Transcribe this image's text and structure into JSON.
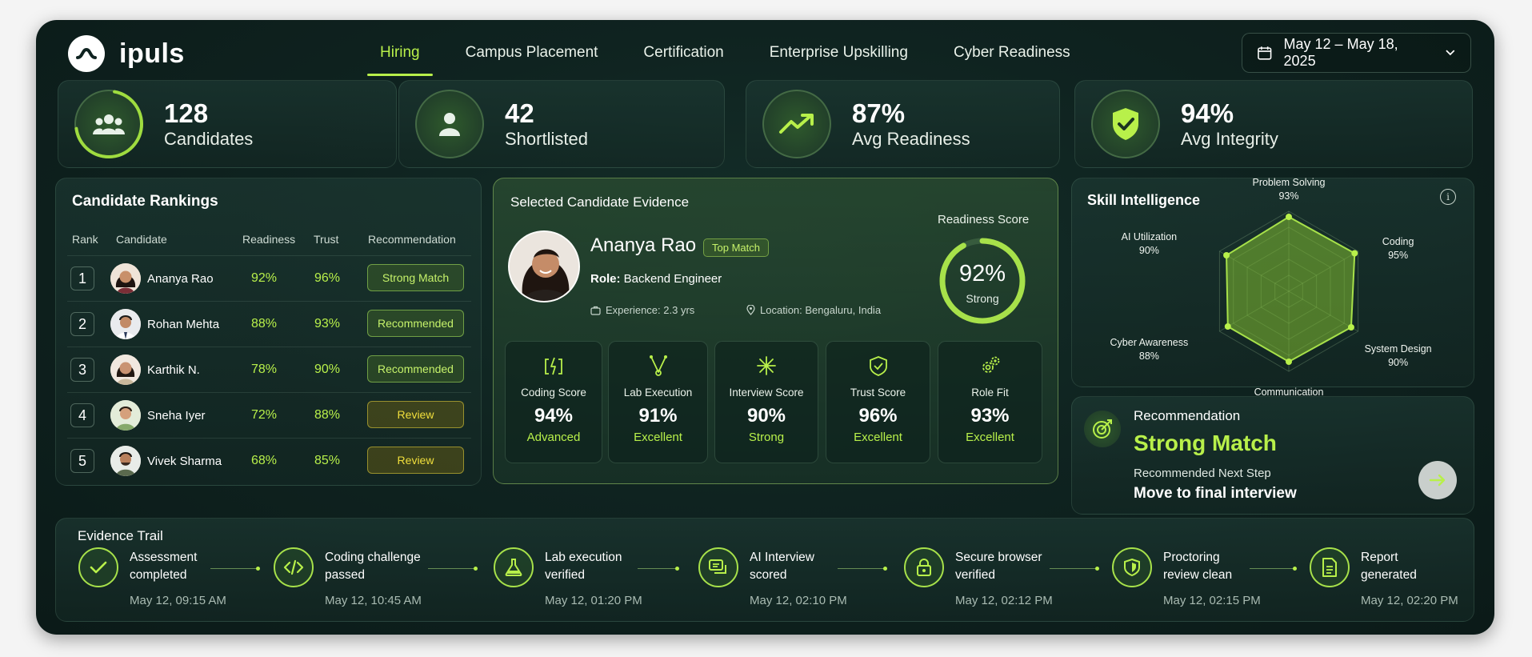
{
  "app": {
    "name": "ipuls"
  },
  "nav": {
    "items": [
      {
        "label": "Hiring",
        "active": true
      },
      {
        "label": "Campus Placement",
        "active": false
      },
      {
        "label": "Certification",
        "active": false
      },
      {
        "label": "Enterprise Upskilling",
        "active": false
      },
      {
        "label": "Cyber Readiness",
        "active": false
      }
    ]
  },
  "date_range": {
    "label": "May 12 – May 18, 2025",
    "icon": "calendar-icon"
  },
  "stats": [
    {
      "value": "128",
      "label": "Candidates",
      "icon": "users-icon"
    },
    {
      "value": "42",
      "label": "Shortlisted",
      "icon": "user-icon"
    },
    {
      "value": "87%",
      "label": "Avg Readiness",
      "icon": "trending-up-icon"
    },
    {
      "value": "94%",
      "label": "Avg Integrity",
      "icon": "shield-check-icon"
    }
  ],
  "rankings": {
    "title": "Candidate Rankings",
    "headers": {
      "rank": "Rank",
      "candidate": "Candidate",
      "readiness": "Readiness",
      "trust": "Trust",
      "recommendation": "Recommendation"
    },
    "rows": [
      {
        "rank": "1",
        "name": "Ananya Rao",
        "readiness": "92%",
        "trust": "96%",
        "recommendation": "Strong Match",
        "tone": "green"
      },
      {
        "rank": "2",
        "name": "Rohan Mehta",
        "readiness": "88%",
        "trust": "93%",
        "recommendation": "Recommended",
        "tone": "green"
      },
      {
        "rank": "3",
        "name": "Karthik N.",
        "readiness": "78%",
        "trust": "90%",
        "recommendation": "Recommended",
        "tone": "green"
      },
      {
        "rank": "4",
        "name": "Sneha Iyer",
        "readiness": "72%",
        "trust": "88%",
        "recommendation": "Review",
        "tone": "yellow"
      },
      {
        "rank": "5",
        "name": "Vivek Sharma",
        "readiness": "68%",
        "trust": "85%",
        "recommendation": "Review",
        "tone": "yellow"
      }
    ]
  },
  "evidence": {
    "title": "Selected Candidate Evidence",
    "name": "Ananya Rao",
    "tag": "Top Match",
    "role_label": "Role:",
    "role": "Backend Engineer",
    "experience": "Experience: 2.3 yrs",
    "location": "Location: Bengaluru, India",
    "readiness_title": "Readiness Score",
    "readiness_value": "92%",
    "readiness_fraction": 0.92,
    "readiness_grade": "Strong",
    "metrics": [
      {
        "label": "Coding Score",
        "value": "94%",
        "grade": "Advanced",
        "icon": "code-bolt-icon"
      },
      {
        "label": "Lab Execution",
        "value": "91%",
        "grade": "Excellent",
        "icon": "flask-icon"
      },
      {
        "label": "Interview Score",
        "value": "90%",
        "grade": "Strong",
        "icon": "sparkle-icon"
      },
      {
        "label": "Trust Score",
        "value": "96%",
        "grade": "Excellent",
        "icon": "shield-icon"
      },
      {
        "label": "Role Fit",
        "value": "93%",
        "grade": "Excellent",
        "icon": "gears-icon"
      }
    ]
  },
  "skills": {
    "title": "Skill Intelligence",
    "axes": [
      {
        "label": "Problem Solving",
        "value": "93%",
        "score": 93
      },
      {
        "label": "Coding",
        "value": "95%",
        "score": 95
      },
      {
        "label": "System Design",
        "value": "90%",
        "score": 90
      },
      {
        "label": "Communication",
        "value": "",
        "score": 88
      },
      {
        "label": "Cyber Awareness",
        "value": "88%",
        "score": 88
      },
      {
        "label": "AI Utilization",
        "value": "90%",
        "score": 90
      }
    ]
  },
  "recommendation": {
    "title": "Recommendation",
    "verdict": "Strong Match",
    "next_label": "Recommended Next Step",
    "next_step": "Move to final interview"
  },
  "trail": {
    "title": "Evidence Trail",
    "steps": [
      {
        "line1": "Assessment",
        "line2": "completed",
        "time": "May 12, 09:15 AM",
        "icon": "check-icon"
      },
      {
        "line1": "Coding challenge",
        "line2": "passed",
        "time": "May 12, 10:45 AM",
        "icon": "code-icon"
      },
      {
        "line1": "Lab execution",
        "line2": "verified",
        "time": "May 12, 01:20 PM",
        "icon": "flask-icon"
      },
      {
        "line1": "AI Interview",
        "line2": "scored",
        "time": "May 12, 02:10 PM",
        "icon": "chat-icon"
      },
      {
        "line1": "Secure browser",
        "line2": "verified",
        "time": "May 12, 02:12 PM",
        "icon": "lock-icon"
      },
      {
        "line1": "Proctoring",
        "line2": "review clean",
        "time": "May 12, 02:15 PM",
        "icon": "shield-icon"
      },
      {
        "line1": "Report",
        "line2": "generated",
        "time": "May 12, 02:20 PM",
        "icon": "document-icon"
      }
    ]
  }
}
